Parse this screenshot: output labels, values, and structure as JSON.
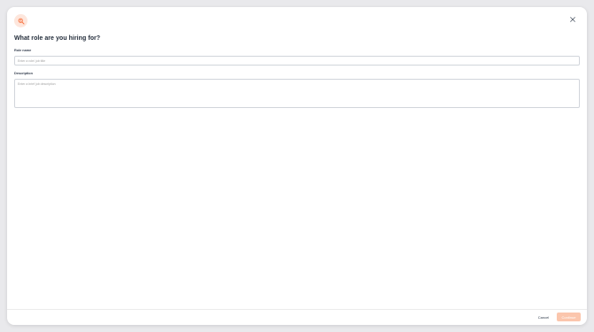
{
  "modal": {
    "title": "What role are you hiring for?",
    "header_icon": "search-user-icon",
    "close_icon": "close-icon",
    "accent_color": "#f97a4a",
    "accent_light": "#fde6dc"
  },
  "form": {
    "role_label": "Role name",
    "role_placeholder": "Enter a role/ job title",
    "role_value": "",
    "description_label": "Description",
    "description_placeholder": "Enter a brief job description",
    "description_value": ""
  },
  "footer": {
    "cancel_label": "Cancel",
    "continue_label": "Continue",
    "continue_color": "#fbc6ad"
  }
}
